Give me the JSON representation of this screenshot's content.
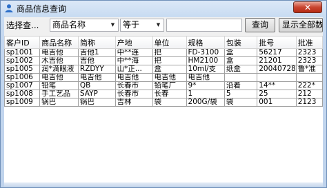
{
  "window": {
    "title": "商品信息查询"
  },
  "toolbar": {
    "query_label": "选择查...",
    "field_value": "商品名称",
    "operator_value": "等于",
    "search_value": "",
    "search_button": "查询",
    "show_all_button": "显示全部数据"
  },
  "table": {
    "columns": [
      "客户ID",
      "商品名称",
      "简称",
      "产地",
      "单位",
      "规格",
      "包装",
      "批号",
      "批准"
    ],
    "rows": [
      [
        "sp1001",
        "电吉他",
        "吉他1",
        "中**连",
        "把",
        "FD-3100",
        "盒",
        "56217",
        "2323"
      ],
      [
        "sp1002",
        "木吉他",
        "吉他",
        "中**海",
        "把",
        "HM2100",
        "盒",
        "21201",
        "2323"
      ],
      [
        "sp1005",
        "润*滴眼液",
        "RZDYY",
        "山*正...",
        "盒",
        "10ml/支",
        "纸盒",
        "20040728",
        "鲁*准"
      ],
      [
        "sp1006",
        "电吉他",
        "电吉他",
        "电吉他",
        "电吉他",
        "电吉他",
        "",
        "",
        ""
      ],
      [
        "sp1007",
        "铅笔",
        "QB",
        "长春市",
        "铅笔厂",
        "9*",
        "沿着",
        "14**",
        "222*"
      ],
      [
        "sp1008",
        "手工艺品",
        "SAYP",
        "长春市",
        "长春",
        "1",
        "5",
        "25",
        "212"
      ],
      [
        "sp1009",
        "锅巴",
        "锅巴",
        "吉林",
        "袋",
        "200G/袋",
        "袋",
        "001",
        "2123"
      ]
    ]
  }
}
